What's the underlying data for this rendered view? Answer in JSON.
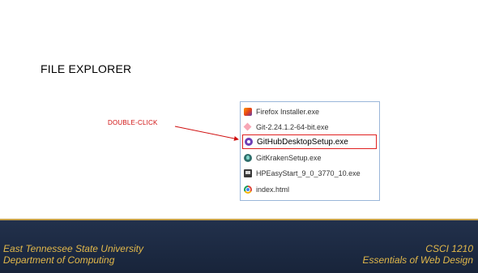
{
  "slide": {
    "title": "FILE EXPLORER",
    "callout": "DOUBLE-CLICK"
  },
  "explorer": {
    "files": [
      {
        "name": "Firefox Installer.exe",
        "icon": "firefox-icon",
        "selected": false
      },
      {
        "name": "Git-2.24.1.2-64-bit.exe",
        "icon": "git-icon",
        "selected": false
      },
      {
        "name": "GitHubDesktopSetup.exe",
        "icon": "github-desktop-icon",
        "selected": true
      },
      {
        "name": "GitKrakenSetup.exe",
        "icon": "gitkraken-icon",
        "selected": false
      },
      {
        "name": "HPEasyStart_9_0_3770_10.exe",
        "icon": "hp-installer-icon",
        "selected": false
      },
      {
        "name": "index.html",
        "icon": "chrome-icon",
        "selected": false
      }
    ],
    "highlight_color": "#e02020"
  },
  "footer": {
    "left_line1": "East Tennessee State University",
    "left_line2": "Department of Computing",
    "right_line1": "CSCI 1210",
    "right_line2": "Essentials of Web Design",
    "accent": "#e2b84a",
    "background": "#1c2a42"
  }
}
